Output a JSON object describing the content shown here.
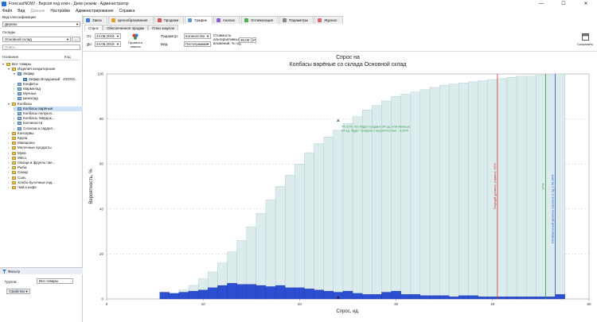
{
  "window": {
    "title": "ForecastNOW! - Версия под ключ - Демо режим - Администратор",
    "controls": [
      "—",
      "☐",
      "✕"
    ]
  },
  "menu": [
    {
      "label": "Файл",
      "enabled": true
    },
    {
      "label": "Вид",
      "enabled": true
    },
    {
      "label": "Данные",
      "enabled": false
    },
    {
      "label": "Настройки",
      "enabled": true
    },
    {
      "label": "Администрирование",
      "enabled": true
    },
    {
      "label": "Справка",
      "enabled": true
    }
  ],
  "left_panel": {
    "classification_label": "Вид классификации",
    "classification_value": "Дерево",
    "warehouses_label": "Склады",
    "warehouse_value": "Основной склад",
    "warehouse_button": "...",
    "search_placeholder": "Поиск...",
    "tree_header": {
      "name": "Название",
      "code": "Код"
    },
    "tree": [
      {
        "label": "Все товары",
        "level": 0,
        "type": "folder",
        "toggle": "▾"
      },
      {
        "label": "Изделия кондитерские",
        "level": 1,
        "type": "folder",
        "toggle": "▾"
      },
      {
        "label": "Зефир",
        "level": 2,
        "type": "folder",
        "toggle": "▾"
      },
      {
        "label": "Зефир Воздушный",
        "level": 3,
        "type": "item",
        "toggle": "",
        "code": "400000..."
      },
      {
        "label": "Конфеты",
        "level": 2,
        "type": "folder",
        "toggle": "›"
      },
      {
        "label": "Мармелад",
        "level": 2,
        "type": "folder",
        "toggle": "›"
      },
      {
        "label": "Мучные",
        "level": 2,
        "type": "folder",
        "toggle": "›"
      },
      {
        "label": "Шоколад",
        "level": 2,
        "type": "folder",
        "toggle": "›"
      },
      {
        "label": "Колбасы",
        "level": 1,
        "type": "folder",
        "toggle": "▾"
      },
      {
        "label": "Колбасы варёные",
        "level": 2,
        "type": "folder",
        "toggle": "›",
        "selected": true
      },
      {
        "label": "Колбасы полукоп...",
        "level": 2,
        "type": "folder",
        "toggle": "›"
      },
      {
        "label": "Колбасы твердок...",
        "level": 2,
        "type": "folder",
        "toggle": "›"
      },
      {
        "label": "Копчености",
        "level": 2,
        "type": "folder",
        "toggle": "›"
      },
      {
        "label": "Сосиски и сардел...",
        "level": 2,
        "type": "folder",
        "toggle": "›"
      },
      {
        "label": "Консервы",
        "level": 1,
        "type": "folder",
        "toggle": "›"
      },
      {
        "label": "Крупа",
        "level": 1,
        "type": "folder",
        "toggle": "›"
      },
      {
        "label": "Макароны",
        "level": 1,
        "type": "folder",
        "toggle": "›"
      },
      {
        "label": "Молочные продукты",
        "level": 1,
        "type": "folder",
        "toggle": "›"
      },
      {
        "label": "Мука",
        "level": 1,
        "type": "folder",
        "toggle": "›"
      },
      {
        "label": "Мясо",
        "level": 1,
        "type": "folder",
        "toggle": "›"
      },
      {
        "label": "Овощи и фрукты све...",
        "level": 1,
        "type": "folder",
        "toggle": "›"
      },
      {
        "label": "Рыба",
        "level": 1,
        "type": "folder",
        "toggle": "›"
      },
      {
        "label": "Сахар",
        "level": 1,
        "type": "folder",
        "toggle": "›"
      },
      {
        "label": "Соль",
        "level": 1,
        "type": "folder",
        "toggle": "›"
      },
      {
        "label": "Хлебо-булочные изд...",
        "level": 1,
        "type": "folder",
        "toggle": "›"
      },
      {
        "label": "Чай и кофе",
        "level": 1,
        "type": "folder",
        "toggle": "›"
      }
    ],
    "filter": {
      "title": "Фильтр",
      "group_label": "Группа:",
      "group_value": "Все товары",
      "property_button": "Свойство"
    }
  },
  "tabs": [
    {
      "label": "Заказ",
      "color": "#3b7bd6"
    },
    {
      "label": "Ценообразование",
      "color": "#e0a020"
    },
    {
      "label": "Продажи",
      "color": "#d9534f"
    },
    {
      "label": "График",
      "color": "#5b9bd5",
      "active": true
    },
    {
      "label": "Анализ",
      "color": "#8a5bd5"
    },
    {
      "label": "Оптимизация",
      "color": "#4caf50"
    },
    {
      "label": "Параметры",
      "color": "#888888"
    },
    {
      "label": "Журнал",
      "color": "#e06666"
    }
  ],
  "subtabs": [
    {
      "label": "Спрос",
      "active": true
    },
    {
      "label": "Обеспеченное продаж",
      "active": false
    },
    {
      "label": "План закупок",
      "active": false
    }
  ],
  "toolbar": {
    "from_label": "От:",
    "from_value": "24.06.2019",
    "to_label": "До:",
    "to_value": "24.06.2019",
    "forecast_label": "Провести анализ",
    "param_label": "Параметр:",
    "param_value": "Количество",
    "view_label": "Вид:",
    "view_value": "Гистограмма",
    "cost_label_1": "Стоимость",
    "cost_label_2": "альтернативных",
    "cost_label_3": "вложений, % год",
    "cost_value": "30,00",
    "save_label": "Сохранить"
  },
  "chart_data": {
    "type": "bar",
    "title": "Спрос на",
    "subtitle": "Колбасы варёные со склада Основной склад",
    "xlabel": "Спрос, ед.",
    "ylabel": "Вероятность, %",
    "xlim": [
      0,
      50
    ],
    "ylim": [
      0,
      100
    ],
    "xticks": [
      0,
      10,
      20,
      30,
      40,
      50
    ],
    "yticks": [
      0,
      20,
      40,
      60,
      80,
      100
    ],
    "grid": true,
    "series": [
      {
        "kind": "cumulative",
        "color": "#dcecec",
        "stroke": "#a8c8d0",
        "x": [
          6,
          7,
          8,
          9,
          10,
          11,
          12,
          13,
          14,
          15,
          16,
          17,
          18,
          19,
          20,
          21,
          22,
          23,
          24,
          25,
          26,
          27,
          28,
          29,
          30,
          31,
          32,
          33,
          34,
          35,
          36,
          37,
          38,
          39,
          40,
          41,
          42,
          43,
          44,
          45,
          46,
          47
        ],
        "values": [
          1,
          2,
          4,
          6,
          9,
          12,
          16,
          21,
          26,
          32,
          38,
          44,
          50,
          55,
          60,
          65,
          69,
          72,
          75,
          78,
          81,
          84,
          86,
          88,
          90,
          91,
          92,
          93,
          94,
          95,
          95.5,
          96,
          96.5,
          97,
          97.5,
          98,
          98.5,
          99,
          99,
          99.5,
          99.5,
          100
        ]
      },
      {
        "kind": "density",
        "color": "#2b4fd0",
        "x": [
          6,
          7,
          8,
          9,
          10,
          11,
          12,
          13,
          14,
          15,
          16,
          17,
          18,
          19,
          20,
          21,
          22,
          23,
          24,
          25,
          26,
          27,
          28,
          29,
          30,
          31,
          32,
          33,
          34,
          35,
          36,
          37,
          38,
          39,
          40,
          41,
          42,
          43,
          44,
          45,
          46,
          47
        ],
        "values": [
          3,
          2.5,
          3,
          3.5,
          4,
          5,
          6,
          7,
          6.5,
          6.5,
          6,
          5.5,
          6,
          5,
          5,
          4.5,
          4,
          3.5,
          3,
          3.5,
          2.5,
          2,
          2,
          3,
          3.5,
          2,
          2,
          1.5,
          1.5,
          1.5,
          1,
          1.5,
          1.5,
          1,
          1,
          1,
          1,
          1,
          1,
          1,
          1,
          2
        ]
      }
    ],
    "vlines": [
      {
        "x": 40.5,
        "color": "#d32f2f",
        "label": "Текущий уровень сервиса: 90%"
      },
      {
        "x": 45.5,
        "color": "#2e9e3e",
        "label": "97%"
      },
      {
        "x": 46.5,
        "color": "#2b4fd0",
        "label": "Оптимальный уровень сервиса (1 ед.): 99,99%"
      }
    ],
    "annotation": {
      "x": 24,
      "y": 79,
      "lines": [
        "79,22%, что будет продано 24 ед. или меньше",
        "24 ед. будет продано с вероятностью : 3,39%"
      ],
      "color": "#2e9e3e"
    }
  }
}
